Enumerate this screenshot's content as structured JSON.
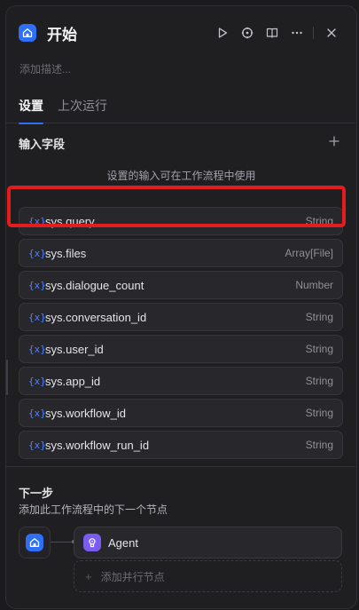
{
  "header": {
    "title": "开始",
    "icon": "home-icon",
    "actions": [
      "play-icon",
      "crosshair-icon",
      "book-icon",
      "more-icon",
      "close-icon"
    ]
  },
  "description_placeholder": "添加描述...",
  "tabs": [
    {
      "label": "设置",
      "active": true
    },
    {
      "label": "上次运行",
      "active": false
    }
  ],
  "input_fields": {
    "title": "输入字段",
    "hint": "设置的输入可在工作流程中使用",
    "variables": [
      {
        "glyph": "{x}",
        "name": "sys.query",
        "type": "String"
      },
      {
        "glyph": "{x}",
        "name": "sys.files",
        "type": "Array[File]"
      },
      {
        "glyph": "{x}",
        "name": "sys.dialogue_count",
        "type": "Number"
      },
      {
        "glyph": "{x}",
        "name": "sys.conversation_id",
        "type": "String"
      },
      {
        "glyph": "{x}",
        "name": "sys.user_id",
        "type": "String"
      },
      {
        "glyph": "{x}",
        "name": "sys.app_id",
        "type": "String"
      },
      {
        "glyph": "{x}",
        "name": "sys.workflow_id",
        "type": "String"
      },
      {
        "glyph": "{x}",
        "name": "sys.workflow_run_id",
        "type": "String"
      }
    ]
  },
  "next_step": {
    "title": "下一步",
    "description": "添加此工作流程中的下一个节点",
    "node_label": "Agent",
    "add_parallel": "添加并行节点"
  },
  "colors": {
    "accent": "#2f6ff7",
    "agent": "#7a5cf0",
    "highlight": "#e51c1c"
  }
}
